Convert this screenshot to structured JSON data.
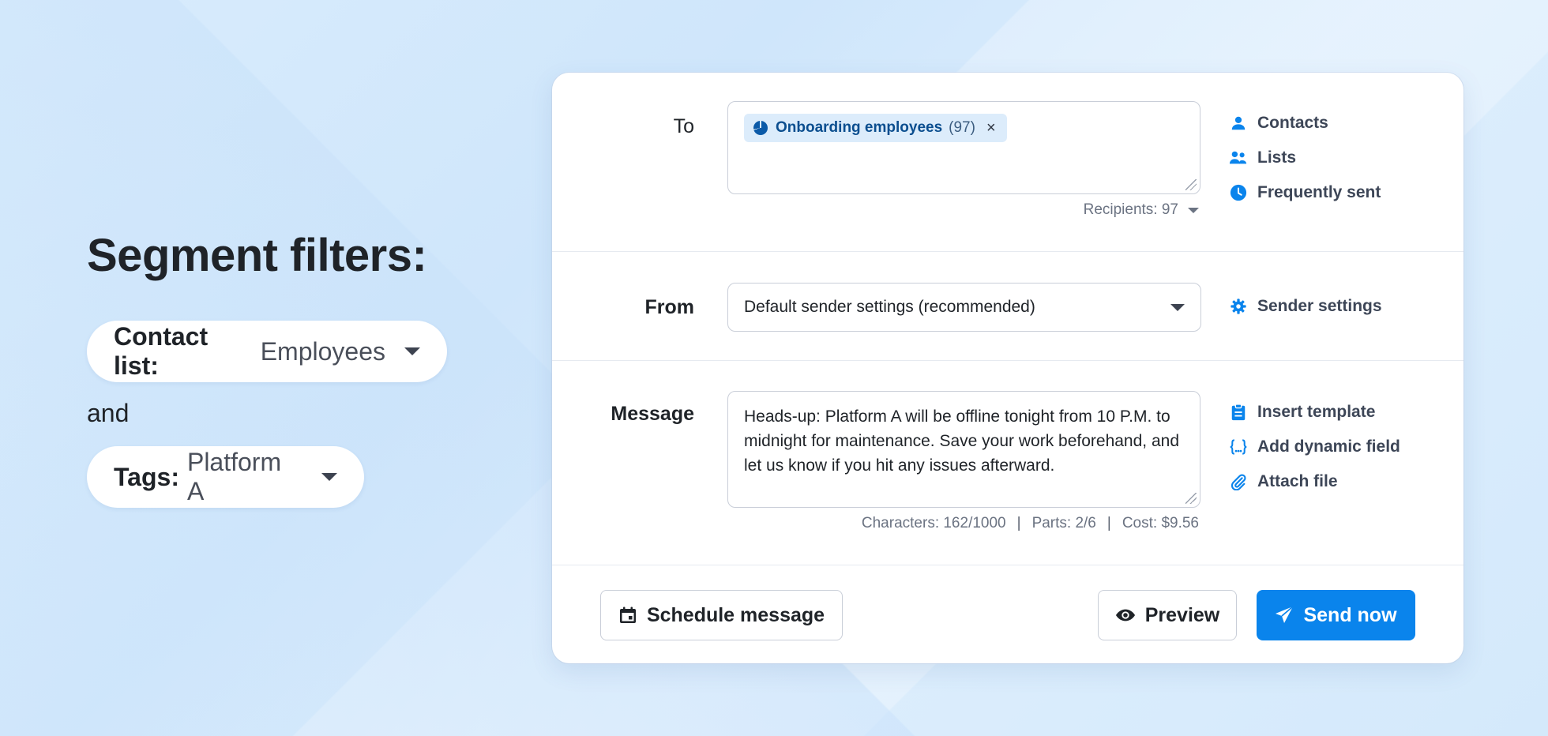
{
  "left_panel": {
    "title": "Segment filters:",
    "filter_contact_key": "Contact list:",
    "filter_contact_value": "Employees",
    "conjunction": "and",
    "filter_tags_key": "Tags:",
    "filter_tags_value": "Platform A"
  },
  "compose": {
    "to": {
      "label": "To",
      "chip_label": "Onboarding employees",
      "chip_count": "(97)",
      "chip_remove": "×",
      "recipients": "Recipients: 97"
    },
    "to_links": [
      {
        "label": "Contacts",
        "icon": "contact-person-icon"
      },
      {
        "label": "Lists",
        "icon": "people-group-icon"
      },
      {
        "label": "Frequently sent",
        "icon": "clock-icon"
      }
    ],
    "from": {
      "label": "From",
      "selected": "Default sender settings (recommended)",
      "settings_link": "Sender settings"
    },
    "message": {
      "label": "Message",
      "text": "Heads-up: Platform A will be offline tonight from 10 P.M. to midnight for maintenance. Save your work beforehand, and let us know if you hit any issues afterward.",
      "characters": "Characters: 162/1000",
      "parts": "Parts: 2/6",
      "cost": "Cost: $9.56",
      "separator": "|"
    },
    "message_links": [
      {
        "label": "Insert template",
        "icon": "clipboard-icon"
      },
      {
        "label": "Add dynamic field",
        "icon": "curly-braces-icon"
      },
      {
        "label": "Attach file",
        "icon": "paperclip-icon"
      }
    ],
    "footer": {
      "schedule": "Schedule message",
      "preview": "Preview",
      "send": "Send now"
    }
  },
  "colors": {
    "accent": "#0a84ec",
    "chip_bg": "#dcecfb",
    "chip_text": "#0b4e8f"
  }
}
